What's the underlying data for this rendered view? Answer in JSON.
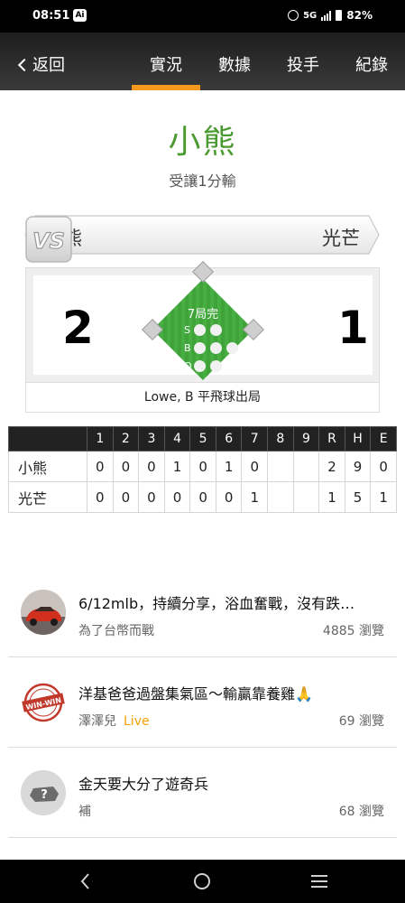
{
  "status_bar": {
    "time": "08:51",
    "ai_badge": "Ai",
    "network": "5G",
    "battery": "82%"
  },
  "nav": {
    "back_label": "返回",
    "tabs": [
      {
        "label": "實況",
        "active": true
      },
      {
        "label": "數據",
        "active": false
      },
      {
        "label": "投手",
        "active": false
      },
      {
        "label": "紀錄",
        "active": false
      }
    ]
  },
  "game": {
    "winner": "小熊",
    "result_text": "受讓1分輸",
    "away_team": "小熊",
    "home_team": "光芒",
    "vs": "VS",
    "away_score": "2",
    "home_score": "1",
    "inning_status": "7局完",
    "count_labels": {
      "s": "S",
      "b": "B",
      "o": "O"
    },
    "counts": {
      "strikes": 2,
      "balls": 3,
      "outs": 2
    },
    "last_play": "Lowe, B 平飛球出局"
  },
  "linescore": {
    "headers": [
      "",
      "1",
      "2",
      "3",
      "4",
      "5",
      "6",
      "7",
      "8",
      "9",
      "R",
      "H",
      "E"
    ],
    "rows": [
      {
        "team": "小熊",
        "cells": [
          "0",
          "0",
          "0",
          "1",
          "0",
          "1",
          "0",
          "",
          "",
          "2",
          "9",
          "0"
        ]
      },
      {
        "team": "光芒",
        "cells": [
          "0",
          "0",
          "0",
          "0",
          "0",
          "0",
          "1",
          "",
          "",
          "1",
          "5",
          "1"
        ]
      }
    ]
  },
  "feed": [
    {
      "title": "6/12mlb，持續分享，浴血奮戰，沒有跌…",
      "author": "為了台幣而戰",
      "live": "",
      "views": "4885 瀏覽",
      "avatar": "car-avatar-icon"
    },
    {
      "title": "洋基爸爸過盤集氣區～輸贏靠養雞🙏",
      "author": "澤澤兒",
      "live": "Live",
      "views": "69 瀏覽",
      "avatar": "win-win-stamp-avatar-icon"
    },
    {
      "title": "金天要大分了遊奇兵",
      "author": "補",
      "live": "",
      "views": "68 瀏覽",
      "avatar": "unknown-user-avatar-icon"
    }
  ],
  "colors": {
    "accent": "#f59a1c",
    "winner_green": "#4b9a31",
    "field_green": "#3fa33a",
    "live_orange": "#f2a100"
  }
}
